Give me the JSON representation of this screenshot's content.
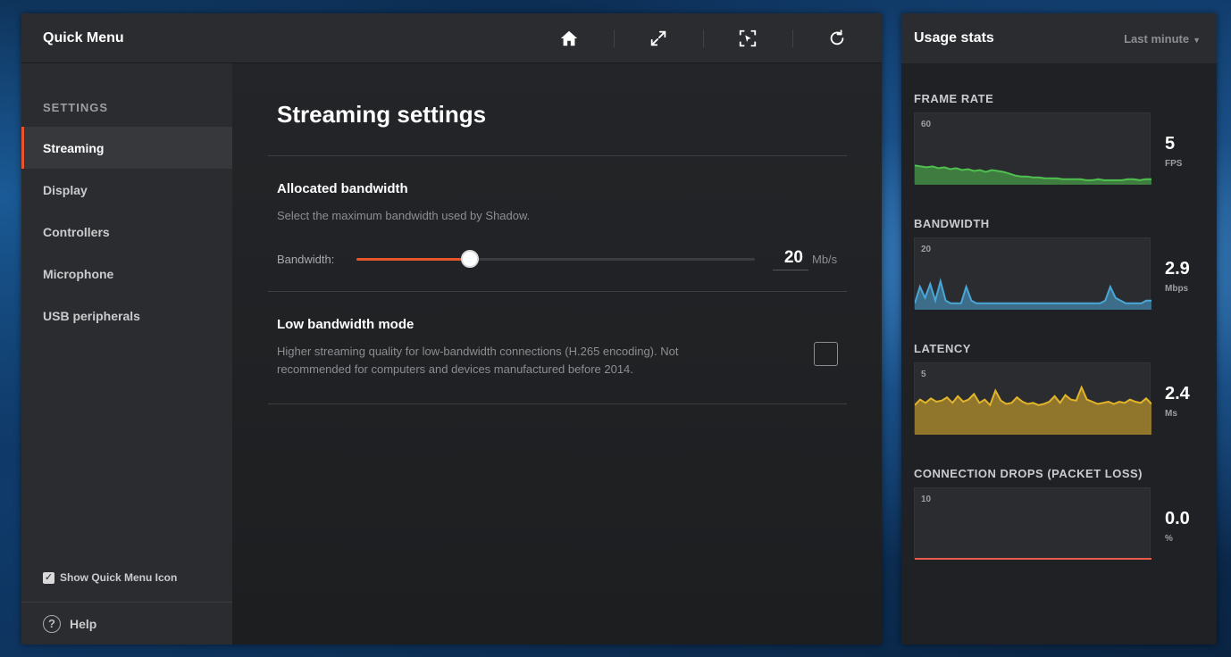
{
  "quick_menu": {
    "title": "Quick Menu",
    "tools": [
      {
        "name": "home-icon"
      },
      {
        "name": "fullscreen-icon"
      },
      {
        "name": "screenshot-icon"
      },
      {
        "name": "refresh-icon"
      }
    ]
  },
  "sidebar": {
    "section": "SETTINGS",
    "items": [
      {
        "label": "Streaming",
        "active": true
      },
      {
        "label": "Display",
        "active": false
      },
      {
        "label": "Controllers",
        "active": false
      },
      {
        "label": "Microphone",
        "active": false
      },
      {
        "label": "USB peripherals",
        "active": false
      }
    ],
    "show_icon_label": "Show Quick Menu Icon",
    "show_icon_checked": true,
    "help_label": "Help"
  },
  "main": {
    "title": "Streaming settings",
    "bandwidth": {
      "heading": "Allocated bandwidth",
      "description": "Select the maximum bandwidth used by Shadow.",
      "slider_label": "Bandwidth:",
      "value": "20",
      "unit": "Mb/s",
      "slider_fraction": 0.285
    },
    "low_bandwidth": {
      "heading": "Low bandwidth mode",
      "description": "Higher streaming quality for low-bandwidth connections (H.265 encoding). Not recommended for computers and devices manufactured before 2014.",
      "checked": false
    }
  },
  "usage_stats": {
    "title": "Usage stats",
    "period": "Last minute",
    "colors": {
      "frame_rate": "#4fc04f",
      "bandwidth": "#4aa6d6",
      "latency": "#e3b52a",
      "packet_loss": "#e85a4a"
    },
    "metrics": [
      {
        "key": "frame_rate",
        "title": "FRAME RATE",
        "max": "60",
        "value": "5",
        "unit": "FPS",
        "ymax": 60,
        "series": [
          20,
          19,
          18,
          19,
          17,
          18,
          16,
          17,
          15,
          16,
          14,
          15,
          13,
          15,
          14,
          13,
          11,
          9,
          8,
          8,
          7,
          7,
          6,
          6,
          6,
          5,
          5,
          5,
          5,
          4,
          4,
          5,
          4,
          4,
          4,
          4,
          5,
          5,
          4,
          5,
          5
        ]
      },
      {
        "key": "bandwidth",
        "title": "BANDWIDTH",
        "max": "20",
        "value": "2.9",
        "unit": "Mbps",
        "ymax": 20,
        "series": [
          2,
          8,
          4,
          9,
          3,
          10,
          3,
          2,
          2,
          2,
          8,
          3,
          2,
          2,
          2,
          2,
          2,
          2,
          2,
          2,
          2,
          2,
          2,
          2,
          2,
          2,
          2,
          2,
          2,
          2,
          2,
          2,
          2,
          2,
          2,
          2,
          2,
          3,
          8,
          4,
          3,
          2,
          2,
          2,
          2,
          3,
          3
        ]
      },
      {
        "key": "latency",
        "title": "LATENCY",
        "max": "5",
        "value": "2.4",
        "unit": "Ms",
        "ymax": 5,
        "series": [
          2.6,
          3.1,
          2.8,
          3.2,
          2.9,
          3.0,
          3.3,
          2.8,
          3.4,
          2.9,
          3.1,
          3.6,
          2.8,
          3.1,
          2.6,
          3.9,
          3.0,
          2.7,
          2.8,
          3.3,
          2.9,
          2.7,
          2.8,
          2.6,
          2.7,
          2.9,
          3.4,
          2.8,
          3.5,
          3.1,
          3.0,
          4.2,
          3.1,
          2.9,
          2.7,
          2.8,
          2.9,
          2.7,
          2.9,
          2.8,
          3.1,
          2.9,
          2.8,
          3.2,
          2.7
        ]
      },
      {
        "key": "packet_loss",
        "title": "CONNECTION DROPS (PACKET LOSS)",
        "max": "10",
        "value": "0.0",
        "unit": "%",
        "ymax": 10,
        "series": [
          0,
          0,
          0,
          0,
          0,
          0,
          0,
          0,
          0,
          0
        ]
      }
    ]
  }
}
